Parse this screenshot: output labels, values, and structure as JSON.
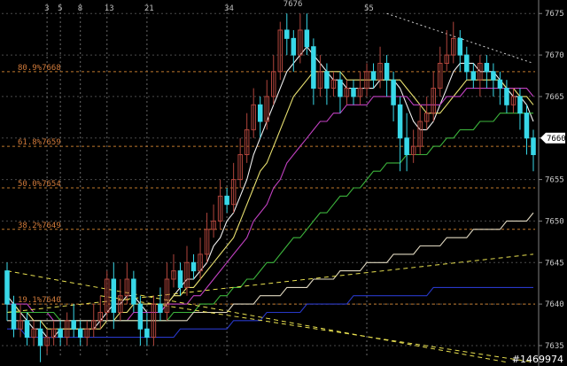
{
  "chart_data": {
    "type": "candlestick",
    "title": "",
    "xlabel": "",
    "ylabel": "",
    "ylim": [
      7633.5,
      7676.5
    ],
    "y_ticks": [
      {
        "value": 7675,
        "label": "7675"
      },
      {
        "value": 7670,
        "label": "7670"
      },
      {
        "value": 7665,
        "label": "7665"
      },
      {
        "value": 7660,
        "label": "7660"
      },
      {
        "value": 7655,
        "label": "7655"
      },
      {
        "value": 7650,
        "label": "7650"
      },
      {
        "value": 7645,
        "label": "7645"
      },
      {
        "value": 7640,
        "label": "7640"
      },
      {
        "value": 7635,
        "label": "7635"
      }
    ],
    "time_labels": [
      "3",
      "5",
      "8",
      "13",
      "21",
      "34",
      "55"
    ],
    "peak_label": {
      "text": "7676",
      "value": 7676
    },
    "fib_levels": [
      {
        "label": "80.9%7668",
        "value": 7668
      },
      {
        "label": "61.8%7659",
        "value": 7659
      },
      {
        "label": "50.0%7654",
        "value": 7654
      },
      {
        "label": "38.2%7649",
        "value": 7649
      },
      {
        "label": "19.1%7640",
        "value": 7640
      }
    ],
    "last_price": {
      "label": "7660",
      "value": 7660
    },
    "grid": true,
    "colors": {
      "up": "#b0453c",
      "down": "#38d8e8",
      "ma_fast": "#f0f0f0",
      "ma_yellow": "#e8e070",
      "ma_magenta": "#c040c0",
      "ma_green": "#3cb43c",
      "ma_slow": "#e0d8c0",
      "ma_blue": "#2838c8",
      "fib": "#c0782c",
      "trend": "#e8e050",
      "last_price_tag": "#ffffff"
    },
    "candles": [
      [
        7644,
        7640,
        7645,
        7638
      ],
      [
        7640,
        7637,
        7641,
        7636
      ],
      [
        7637,
        7638,
        7640,
        7636
      ],
      [
        7638,
        7636,
        7639,
        7635
      ],
      [
        7636,
        7637,
        7638,
        7635
      ],
      [
        7637,
        7635,
        7638,
        7633
      ],
      [
        7635,
        7636,
        7637,
        7634
      ],
      [
        7636,
        7637,
        7638,
        7635
      ],
      [
        7637,
        7636,
        7638,
        7635
      ],
      [
        7636,
        7638,
        7639,
        7635
      ],
      [
        7638,
        7637,
        7640,
        7636
      ],
      [
        7637,
        7636,
        7638,
        7635
      ],
      [
        7636,
        7637,
        7638,
        7635
      ],
      [
        7637,
        7638,
        7640,
        7636
      ],
      [
        7638,
        7639,
        7641,
        7637
      ],
      [
        7639,
        7643,
        7644,
        7638
      ],
      [
        7643,
        7639,
        7645,
        7637
      ],
      [
        7639,
        7641,
        7643,
        7638
      ],
      [
        7641,
        7643,
        7645,
        7640
      ],
      [
        7643,
        7640,
        7644,
        7639
      ],
      [
        7640,
        7637,
        7641,
        7635
      ],
      [
        7637,
        7636,
        7639,
        7635
      ],
      [
        7636,
        7640,
        7641,
        7635
      ],
      [
        7640,
        7639,
        7642,
        7638
      ],
      [
        7639,
        7643,
        7645,
        7638
      ],
      [
        7643,
        7644,
        7646,
        7642
      ],
      [
        7644,
        7642,
        7645,
        7641
      ],
      [
        7642,
        7645,
        7647,
        7641
      ],
      [
        7645,
        7644,
        7646,
        7643
      ],
      [
        7644,
        7646,
        7648,
        7643
      ],
      [
        7646,
        7649,
        7651,
        7645
      ],
      [
        7649,
        7650,
        7652,
        7648
      ],
      [
        7650,
        7653,
        7655,
        7649
      ],
      [
        7653,
        7652,
        7654,
        7651
      ],
      [
        7652,
        7655,
        7657,
        7651
      ],
      [
        7655,
        7658,
        7660,
        7654
      ],
      [
        7658,
        7661,
        7663,
        7657
      ],
      [
        7661,
        7664,
        7666,
        7660
      ],
      [
        7664,
        7662,
        7665,
        7660
      ],
      [
        7662,
        7665,
        7667,
        7661
      ],
      [
        7665,
        7668,
        7670,
        7664
      ],
      [
        7668,
        7673,
        7674,
        7667
      ],
      [
        7673,
        7672,
        7675,
        7670
      ],
      [
        7672,
        7670,
        7673,
        7668
      ],
      [
        7670,
        7673,
        7675,
        7669
      ],
      [
        7673,
        7671,
        7675,
        7670
      ],
      [
        7671,
        7666,
        7672,
        7664
      ],
      [
        7666,
        7668,
        7670,
        7665
      ],
      [
        7668,
        7666,
        7669,
        7664
      ],
      [
        7666,
        7667,
        7668,
        7665
      ],
      [
        7667,
        7665,
        7668,
        7663
      ],
      [
        7665,
        7666,
        7667,
        7664
      ],
      [
        7666,
        7665,
        7667,
        7664
      ],
      [
        7665,
        7666,
        7668,
        7664
      ],
      [
        7666,
        7668,
        7669,
        7665
      ],
      [
        7668,
        7667,
        7669,
        7666
      ],
      [
        7667,
        7669,
        7671,
        7666
      ],
      [
        7669,
        7667,
        7670,
        7665
      ],
      [
        7667,
        7664,
        7668,
        7662
      ],
      [
        7664,
        7660,
        7665,
        7656
      ],
      [
        7660,
        7658,
        7663,
        7656
      ],
      [
        7658,
        7659,
        7661,
        7657
      ],
      [
        7659,
        7662,
        7664,
        7658
      ],
      [
        7662,
        7663,
        7665,
        7661
      ],
      [
        7663,
        7666,
        7668,
        7662
      ],
      [
        7666,
        7669,
        7671,
        7665
      ],
      [
        7669,
        7670,
        7673,
        7668
      ],
      [
        7670,
        7672,
        7674,
        7669
      ],
      [
        7672,
        7670,
        7673,
        7668
      ],
      [
        7670,
        7668,
        7671,
        7667
      ],
      [
        7668,
        7667,
        7669,
        7666
      ],
      [
        7667,
        7669,
        7670,
        7665
      ],
      [
        7669,
        7668,
        7670,
        7666
      ],
      [
        7668,
        7667,
        7669,
        7665
      ],
      [
        7667,
        7666,
        7668,
        7664
      ],
      [
        7666,
        7664,
        7667,
        7663
      ],
      [
        7664,
        7665,
        7666,
        7663
      ],
      [
        7665,
        7663,
        7666,
        7661
      ],
      [
        7663,
        7660,
        7664,
        7658
      ],
      [
        7660,
        7658,
        7661,
        7656
      ]
    ],
    "moving_averages": [
      {
        "key": "ma_fast",
        "values": [
          7641,
          7640,
          7639,
          7638,
          7637,
          7637,
          7636,
          7636,
          7637,
          7637,
          7637,
          7637,
          7637,
          7637,
          7638,
          7639,
          7640,
          7640,
          7641,
          7641,
          7640,
          7639,
          7639,
          7639,
          7640,
          7641,
          7642,
          7643,
          7643,
          7644,
          7645,
          7647,
          7648,
          7650,
          7651,
          7653,
          7655,
          7658,
          7660,
          7662,
          7664,
          7666,
          7668,
          7669,
          7670,
          7671,
          7670,
          7669,
          7668,
          7667,
          7667,
          7666,
          7666,
          7666,
          7666,
          7666,
          7667,
          7667,
          7667,
          7666,
          7664,
          7662,
          7661,
          7661,
          7662,
          7664,
          7666,
          7668,
          7669,
          7669,
          7669,
          7668,
          7668,
          7668,
          7667,
          7666,
          7665,
          7665,
          7664,
          7662
        ]
      },
      {
        "key": "ma_yellow",
        "values": [
          7640,
          7640,
          7639,
          7639,
          7638,
          7638,
          7637,
          7637,
          7637,
          7637,
          7637,
          7637,
          7637,
          7637,
          7637,
          7638,
          7638,
          7639,
          7639,
          7640,
          7640,
          7640,
          7640,
          7640,
          7640,
          7641,
          7641,
          7642,
          7642,
          7643,
          7644,
          7645,
          7646,
          7647,
          7648,
          7650,
          7652,
          7654,
          7656,
          7657,
          7659,
          7661,
          7663,
          7665,
          7666,
          7667,
          7668,
          7668,
          7668,
          7668,
          7668,
          7667,
          7667,
          7667,
          7667,
          7667,
          7667,
          7667,
          7667,
          7667,
          7666,
          7665,
          7664,
          7663,
          7663,
          7663,
          7664,
          7665,
          7666,
          7667,
          7667,
          7667,
          7667,
          7667,
          7667,
          7666,
          7666,
          7665,
          7665,
          7664
        ]
      },
      {
        "key": "ma_magenta",
        "values": [
          7640,
          7640,
          7640,
          7640,
          7639,
          7639,
          7639,
          7638,
          7638,
          7638,
          7638,
          7638,
          7638,
          7638,
          7638,
          7638,
          7638,
          7638,
          7638,
          7639,
          7639,
          7639,
          7639,
          7639,
          7640,
          7640,
          7640,
          7640,
          7641,
          7641,
          7642,
          7643,
          7644,
          7645,
          7646,
          7647,
          7648,
          7650,
          7651,
          7652,
          7654,
          7655,
          7657,
          7658,
          7659,
          7660,
          7661,
          7662,
          7662,
          7663,
          7663,
          7664,
          7664,
          7664,
          7664,
          7665,
          7665,
          7665,
          7665,
          7665,
          7665,
          7664,
          7664,
          7664,
          7664,
          7664,
          7665,
          7665,
          7665,
          7666,
          7666,
          7666,
          7666,
          7666,
          7666,
          7666,
          7666,
          7666,
          7666,
          7665
        ]
      },
      {
        "key": "ma_green",
        "values": [
          7639,
          7639,
          7639,
          7639,
          7639,
          7639,
          7639,
          7639,
          7638,
          7638,
          7638,
          7638,
          7638,
          7638,
          7638,
          7638,
          7638,
          7638,
          7638,
          7638,
          7638,
          7638,
          7638,
          7638,
          7638,
          7639,
          7639,
          7639,
          7639,
          7640,
          7640,
          7640,
          7641,
          7641,
          7642,
          7642,
          7643,
          7643,
          7644,
          7645,
          7645,
          7646,
          7647,
          7648,
          7648,
          7649,
          7650,
          7651,
          7651,
          7652,
          7653,
          7653,
          7654,
          7654,
          7655,
          7656,
          7656,
          7657,
          7657,
          7657,
          7658,
          7658,
          7658,
          7658,
          7659,
          7659,
          7660,
          7660,
          7661,
          7661,
          7661,
          7662,
          7662,
          7662,
          7663,
          7663,
          7663,
          7663,
          7663,
          7663
        ]
      },
      {
        "key": "ma_slow",
        "values": [
          7638,
          7638,
          7638,
          7638,
          7638,
          7638,
          7638,
          7638,
          7638,
          7638,
          7638,
          7638,
          7638,
          7638,
          7638,
          7638,
          7638,
          7638,
          7638,
          7638,
          7638,
          7638,
          7638,
          7638,
          7638,
          7638,
          7638,
          7638,
          7639,
          7639,
          7639,
          7639,
          7639,
          7639,
          7640,
          7640,
          7640,
          7640,
          7641,
          7641,
          7641,
          7641,
          7642,
          7642,
          7642,
          7642,
          7643,
          7643,
          7643,
          7643,
          7644,
          7644,
          7644,
          7644,
          7645,
          7645,
          7645,
          7645,
          7646,
          7646,
          7646,
          7646,
          7647,
          7647,
          7647,
          7647,
          7648,
          7648,
          7648,
          7648,
          7649,
          7649,
          7649,
          7649,
          7649,
          7650,
          7650,
          7650,
          7650,
          7651
        ]
      },
      {
        "key": "ma_blue",
        "values": [
          7637,
          7637,
          7637,
          7636,
          7636,
          7636,
          7636,
          7636,
          7636,
          7636,
          7636,
          7636,
          7636,
          7636,
          7636,
          7636,
          7636,
          7636,
          7636,
          7636,
          7636,
          7636,
          7636,
          7636,
          7636,
          7636,
          7637,
          7637,
          7637,
          7637,
          7637,
          7637,
          7637,
          7637,
          7638,
          7638,
          7638,
          7638,
          7638,
          7639,
          7639,
          7639,
          7639,
          7639,
          7639,
          7640,
          7640,
          7640,
          7640,
          7640,
          7640,
          7640,
          7641,
          7641,
          7641,
          7641,
          7641,
          7641,
          7641,
          7641,
          7641,
          7641,
          7641,
          7641,
          7642,
          7642,
          7642,
          7642,
          7642,
          7642,
          7642,
          7642,
          7642,
          7642,
          7642,
          7642,
          7642,
          7642,
          7642,
          7642
        ]
      }
    ],
    "trend_lines": [
      {
        "from": [
          0,
          7644
        ],
        "to": [
          75,
          7633
        ]
      },
      {
        "from": [
          0,
          7639
        ],
        "to": [
          79,
          7646
        ]
      },
      {
        "from": [
          14,
          7641
        ],
        "to": [
          79,
          7633
        ]
      }
    ],
    "resistance_line": {
      "from": [
        57,
        7675
      ],
      "to": [
        79,
        7669
      ]
    }
  },
  "watermark": "#1469974"
}
